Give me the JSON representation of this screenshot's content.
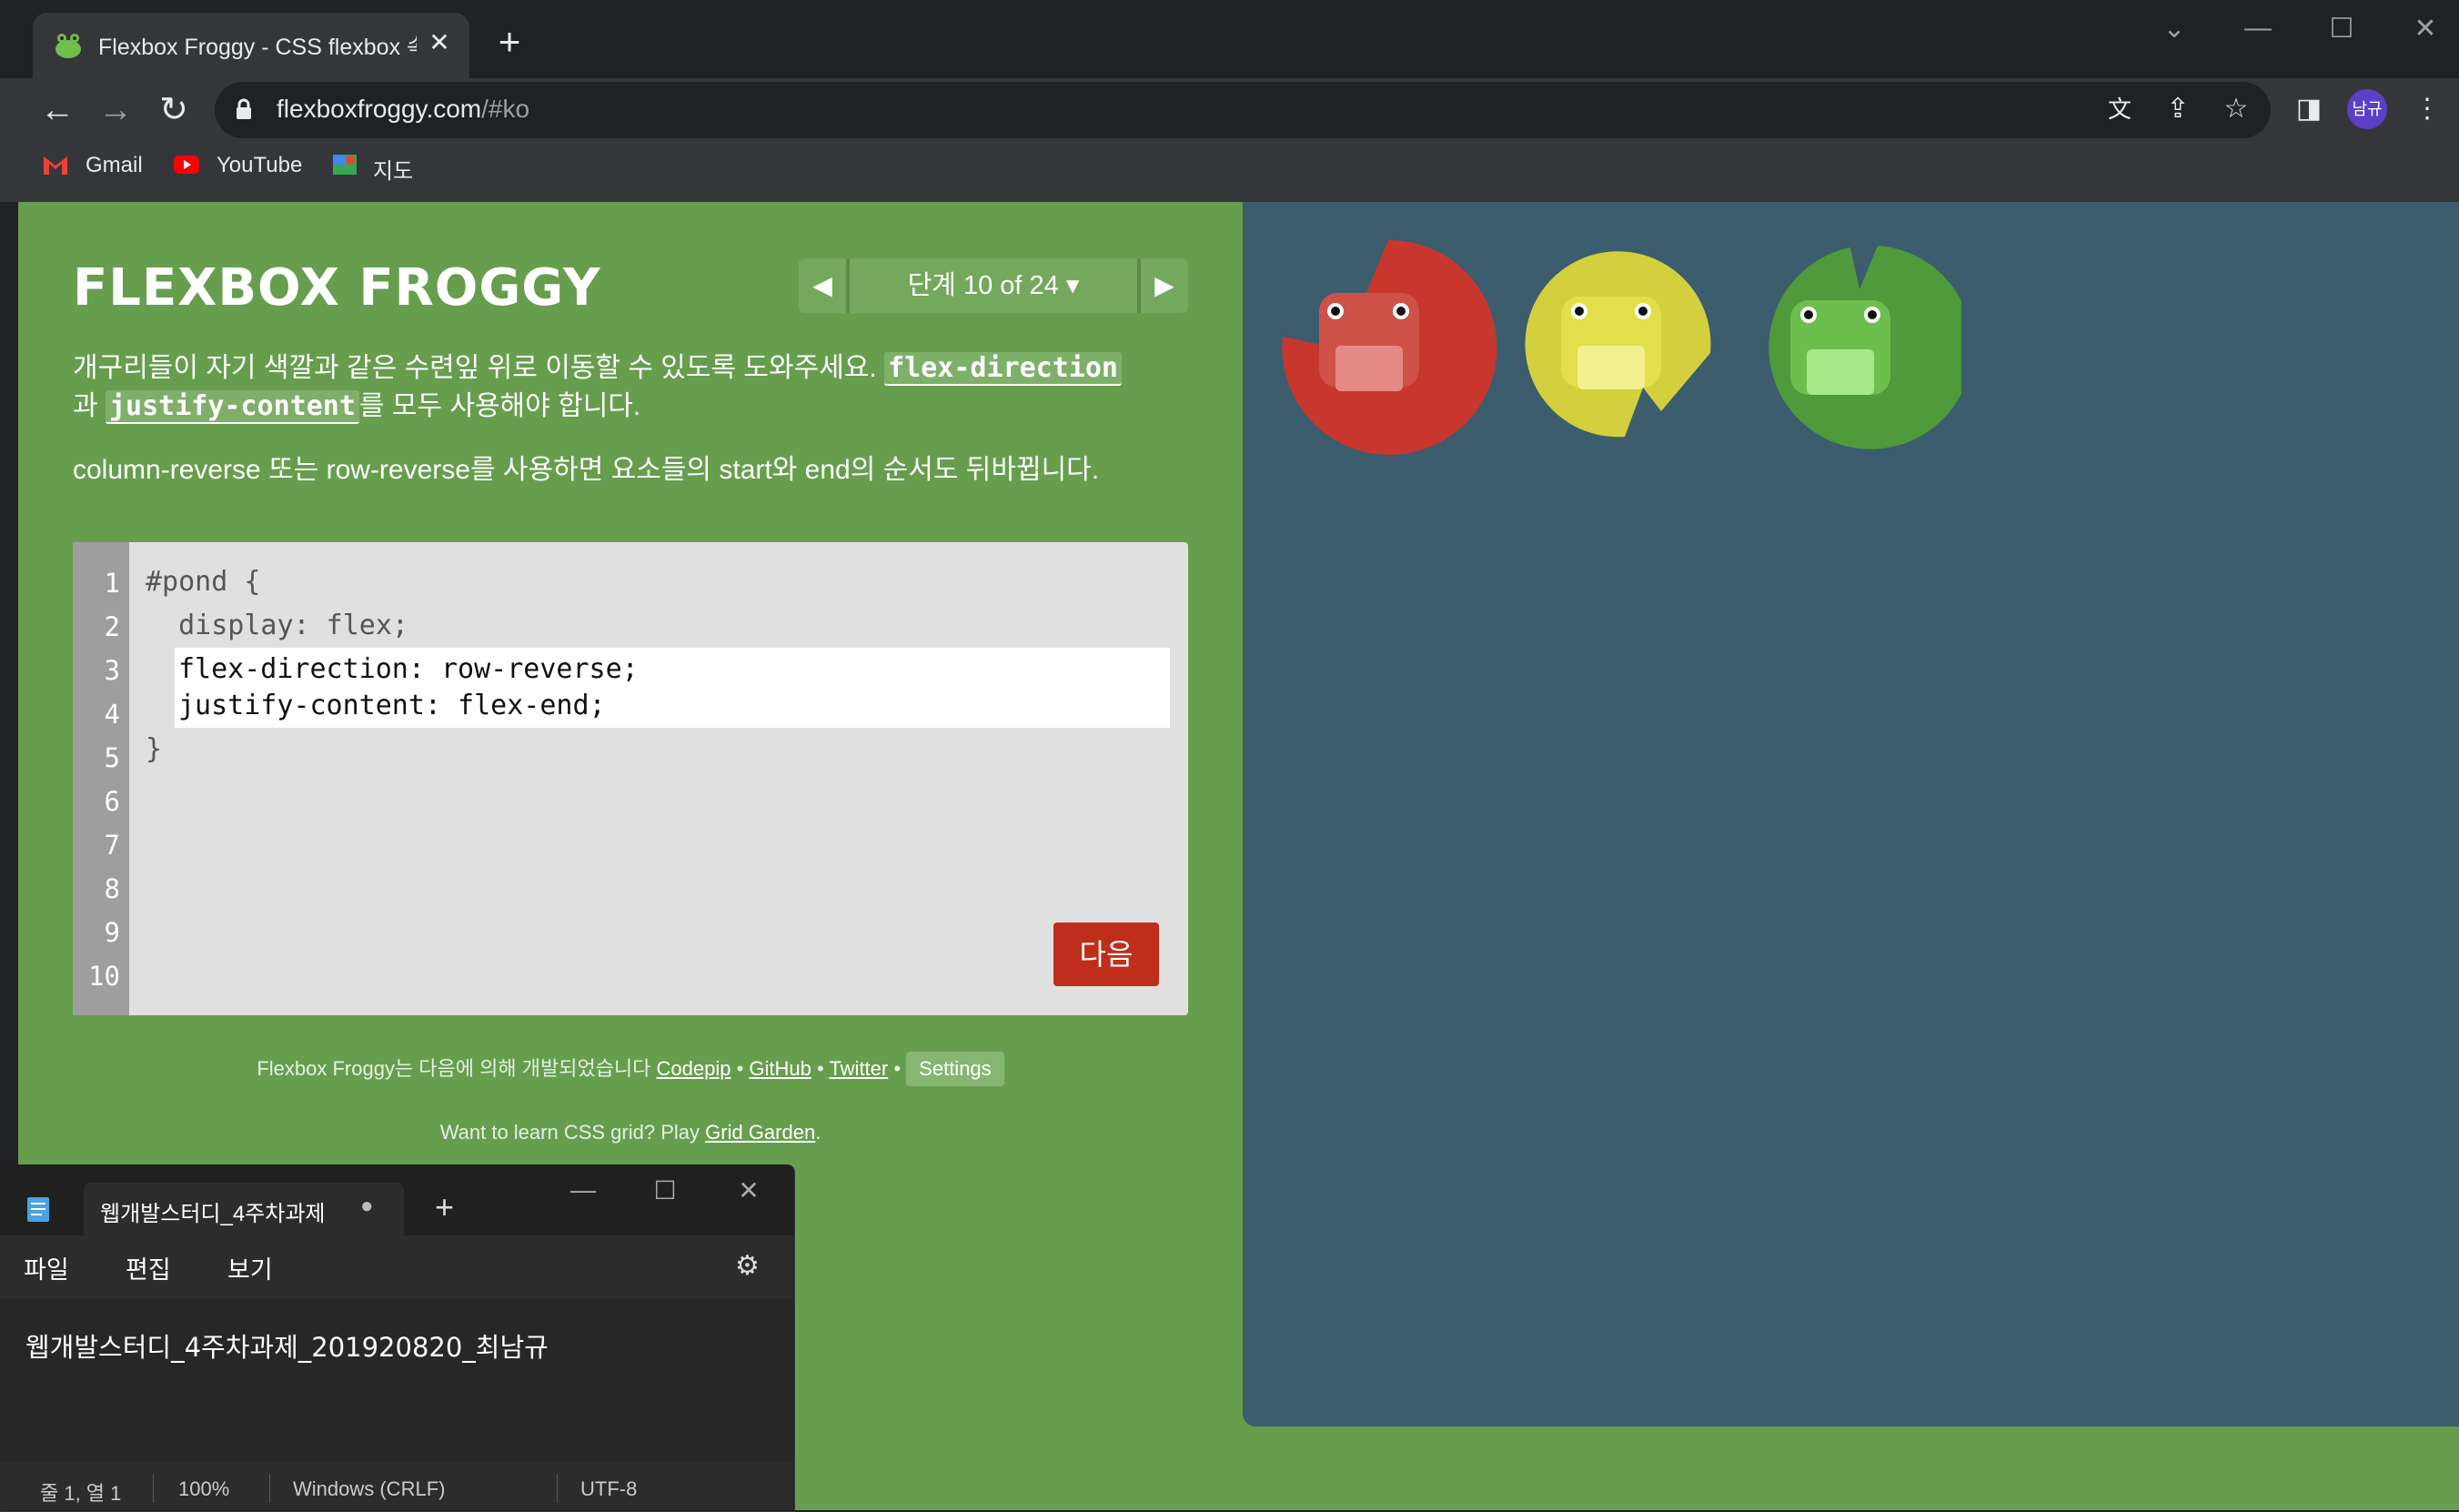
{
  "browser": {
    "tab_title": "Flexbox Froggy - CSS flexbox 속",
    "tab_close": "✕",
    "new_tab": "+",
    "url_host": "flexboxfroggy.com",
    "url_path": "/#ko",
    "avatar_label": "남규",
    "bookmarks": [
      {
        "label": "Gmail",
        "icon": "gmail-icon"
      },
      {
        "label": "YouTube",
        "icon": "youtube-icon"
      },
      {
        "label": "지도",
        "icon": "maps-icon"
      }
    ]
  },
  "game": {
    "logo": "FLEXBOX FROGGY",
    "level_label": "단계 10 of 24 ▾",
    "level_prev": "◀",
    "level_next": "▶",
    "instruction_a": "개구리들이 자기 색깔과 같은 수련잎 위로 이동할 수 있도록 도와주세요.",
    "instruction_code1": "flex-direction",
    "instruction_b": "과",
    "instruction_code2": "justify-content",
    "instruction_c": "를 모두 사용해야 합니다.",
    "hint": "column-reverse 또는 row-reverse를 사용하면 요소들의 start와 end의 순서도 뒤바뀝니다.",
    "line_numbers": [
      "1",
      "2",
      "3",
      "4",
      "5",
      "6",
      "7",
      "8",
      "9",
      "10"
    ],
    "code_line1": "#pond {",
    "code_line2": "  display: flex;",
    "input_line1": "flex-direction: row-reverse;",
    "input_line2": "justify-content: flex-end;",
    "code_close": "}",
    "next_button": "다음",
    "footer_text": "Flexbox Froggy는 다음에 의해 개발되었습니다",
    "footer_codepip": "Codepip",
    "footer_github": "GitHub",
    "footer_twitter": "Twitter",
    "footer_settings": "Settings",
    "footer2_text": "Want to learn CSS grid? Play",
    "footer2_link": "Grid Garden",
    "frogs": [
      "red",
      "yellow",
      "green"
    ],
    "colors": {
      "red": "#c8372d",
      "yellow": "#d4cf3c",
      "green": "#4f9a3b",
      "pond": "#3b5d6e",
      "page": "#669e4e"
    }
  },
  "notepad": {
    "tab_title": "웹개발스터디_4주차과제",
    "tab_dot": "●",
    "plus": "+",
    "menu": [
      "파일",
      "편집",
      "보기"
    ],
    "content": "웹개발스터디_4주차과제_201920820_최남규",
    "status": {
      "position": "줄 1, 열 1",
      "zoom": "100%",
      "line_ending": "Windows (CRLF)",
      "encoding": "UTF-8"
    }
  }
}
